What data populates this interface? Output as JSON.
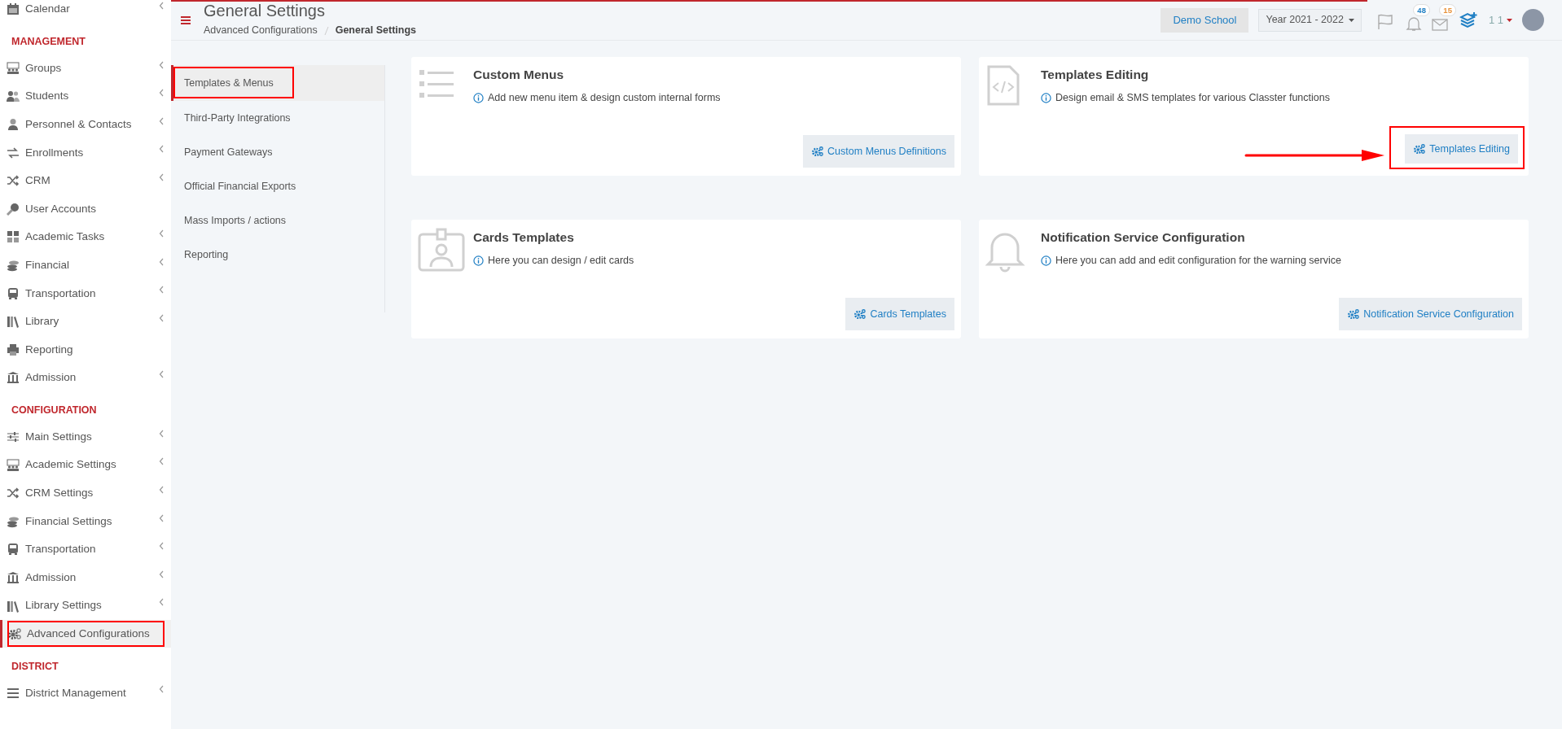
{
  "sidebar": {
    "items": [
      {
        "kind": "item",
        "label": "Calendar",
        "expandable": true,
        "selected": false,
        "annotated": false
      },
      {
        "kind": "header",
        "label": "MANAGEMENT"
      },
      {
        "kind": "item",
        "label": "Groups",
        "expandable": true,
        "selected": false,
        "annotated": false
      },
      {
        "kind": "item",
        "label": "Students",
        "expandable": true,
        "selected": false,
        "annotated": false
      },
      {
        "kind": "item",
        "label": "Personnel & Contacts",
        "expandable": true,
        "selected": false,
        "annotated": false
      },
      {
        "kind": "item",
        "label": "Enrollments",
        "expandable": true,
        "selected": false,
        "annotated": false
      },
      {
        "kind": "item",
        "label": "CRM",
        "expandable": true,
        "selected": false,
        "annotated": false
      },
      {
        "kind": "item",
        "label": "User Accounts",
        "expandable": false,
        "selected": false,
        "annotated": false
      },
      {
        "kind": "item",
        "label": "Academic Tasks",
        "expandable": true,
        "selected": false,
        "annotated": false
      },
      {
        "kind": "item",
        "label": "Financial",
        "expandable": true,
        "selected": false,
        "annotated": false
      },
      {
        "kind": "item",
        "label": "Transportation",
        "expandable": true,
        "selected": false,
        "annotated": false
      },
      {
        "kind": "item",
        "label": "Library",
        "expandable": true,
        "selected": false,
        "annotated": false
      },
      {
        "kind": "item",
        "label": "Reporting",
        "expandable": false,
        "selected": false,
        "annotated": false
      },
      {
        "kind": "item",
        "label": "Admission",
        "expandable": true,
        "selected": false,
        "annotated": false
      },
      {
        "kind": "header",
        "label": "CONFIGURATION"
      },
      {
        "kind": "item",
        "label": "Main Settings",
        "expandable": true,
        "selected": false,
        "annotated": false
      },
      {
        "kind": "item",
        "label": "Academic Settings",
        "expandable": true,
        "selected": false,
        "annotated": false
      },
      {
        "kind": "item",
        "label": "CRM Settings",
        "expandable": true,
        "selected": false,
        "annotated": false
      },
      {
        "kind": "item",
        "label": "Financial Settings",
        "expandable": true,
        "selected": false,
        "annotated": false
      },
      {
        "kind": "item",
        "label": "Transportation",
        "expandable": true,
        "selected": false,
        "annotated": false
      },
      {
        "kind": "item",
        "label": "Admission",
        "expandable": true,
        "selected": false,
        "annotated": false
      },
      {
        "kind": "item",
        "label": "Library Settings",
        "expandable": true,
        "selected": false,
        "annotated": false
      },
      {
        "kind": "item",
        "label": "Advanced Configurations",
        "expandable": false,
        "selected": true,
        "annotated": true
      },
      {
        "kind": "header",
        "label": "DISTRICT"
      },
      {
        "kind": "item",
        "label": "District Management",
        "expandable": true,
        "selected": false,
        "annotated": false
      }
    ]
  },
  "header": {
    "loading_bar": {
      "level": 0.86
    },
    "title": "General Settings",
    "breadcrumb": [
      {
        "label": "Advanced Configurations",
        "current": false
      },
      {
        "label": "General Settings",
        "current": true
      }
    ],
    "school": "Demo School",
    "year": "Year 2021 - 2022",
    "notifications": "48",
    "messages": "15",
    "user": "1 1"
  },
  "submenu": [
    {
      "label": "Templates & Menus",
      "selected": true,
      "annotated": true
    },
    {
      "label": "Third-Party Integrations",
      "selected": false,
      "annotated": false
    },
    {
      "label": "Payment Gateways",
      "selected": false,
      "annotated": false
    },
    {
      "label": "Official Financial Exports",
      "selected": false,
      "annotated": false
    },
    {
      "label": "Mass Imports / actions",
      "selected": false,
      "annotated": false
    },
    {
      "label": "Reporting",
      "selected": false,
      "annotated": false
    }
  ],
  "cards": [
    {
      "title": "Custom Menus",
      "description": "Add new menu item & design custom internal forms",
      "button": "Custom Menus Definitions",
      "button_annotated": false,
      "pointer_arrow": false
    },
    {
      "title": "Templates Editing",
      "description": "Design email & SMS templates for various Classter functions",
      "button": "Templates Editing",
      "button_annotated": true,
      "pointer_arrow": true
    },
    {
      "title": "Cards Templates",
      "description": "Here you can design / edit cards",
      "button": "Cards Templates",
      "button_annotated": false,
      "pointer_arrow": false
    },
    {
      "title": "Notification Service Configuration",
      "description": "Here you can add and edit configuration for the warning service",
      "button": "Notification Service Configuration",
      "button_annotated": false,
      "pointer_arrow": false
    }
  ]
}
